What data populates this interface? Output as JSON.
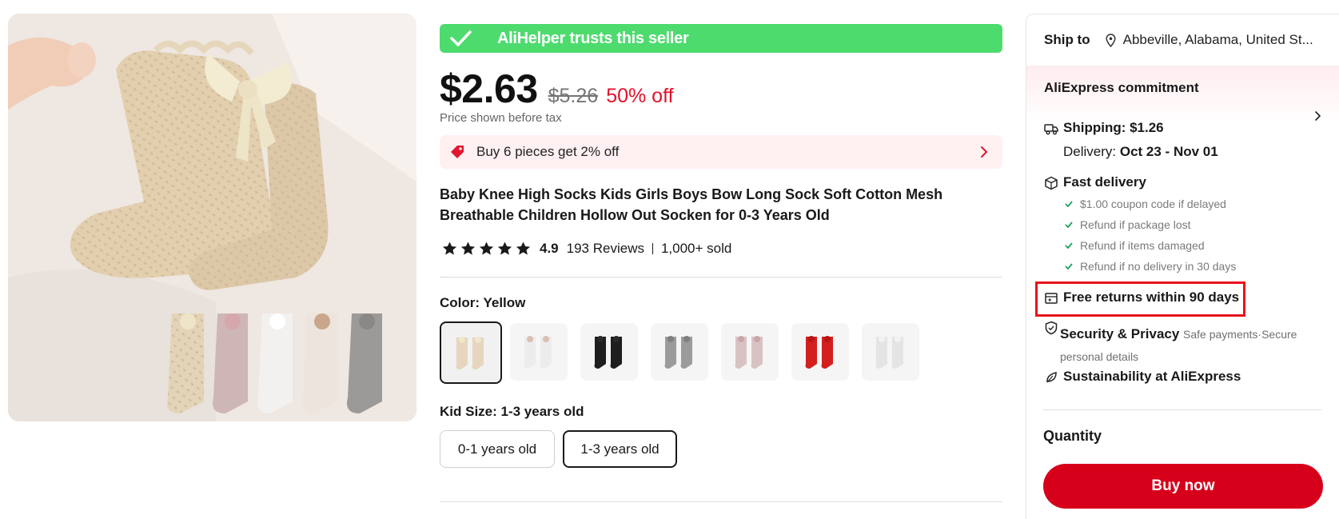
{
  "trust_banner": {
    "text": "AliHelper trusts this seller",
    "color": "#4ddb6e"
  },
  "price": {
    "current": "$2.63",
    "original": "$5.26",
    "discount": "50% off",
    "tax_note": "Price shown before tax"
  },
  "promo": {
    "text": "Buy 6 pieces get 2% off"
  },
  "product": {
    "title": "Baby Knee High Socks Kids Girls Boys Bow Long Sock Soft Cotton Mesh Breathable Children Hollow Out Socken for 0-3 Years Old",
    "rating": "4.9",
    "stars": 5,
    "reviews": "193 Reviews",
    "sold": "1,000+ sold"
  },
  "color": {
    "label": "Color: ",
    "selected": "Yellow",
    "swatches": [
      {
        "name": "yellow",
        "color": "#e6d6bd",
        "bow": "#efe6cc"
      },
      {
        "name": "white",
        "color": "#ececec",
        "bow": "#d9c0b3"
      },
      {
        "name": "black",
        "color": "#1e1e1e",
        "bow": "#2a2a2a"
      },
      {
        "name": "gray",
        "color": "#9b9b9b",
        "bow": "#7f7f7f"
      },
      {
        "name": "pink",
        "color": "#d8c3c3",
        "bow": "#c9a6a6"
      },
      {
        "name": "red",
        "color": "#d41f1f",
        "bow": "#b81515"
      },
      {
        "name": "light-white",
        "color": "#e4e4e4",
        "bow": "#f2f2f2"
      }
    ]
  },
  "size": {
    "label": "Kid Size: ",
    "selected": "1-3 years old",
    "options": [
      "0-1 years old",
      "1-3 years old"
    ]
  },
  "side": {
    "ship_to_label": "Ship to",
    "ship_to_address": "Abbeville, Alabama, United St...",
    "commitment_title": "AliExpress commitment",
    "shipping_label": "Shipping: $1.26",
    "delivery_label": "Delivery: ",
    "delivery_dates": "Oct 23 - Nov 01",
    "fast_delivery_title": "Fast delivery",
    "fast_delivery_items": [
      "$1.00 coupon code if delayed",
      "Refund if package lost",
      "Refund if items damaged",
      "Refund if no delivery in 30 days"
    ],
    "free_returns": "Free returns within 90 days",
    "security_title": "Security & Privacy",
    "security_desc": "Safe payments·Secure personal details",
    "sustainability": "Sustainability at AliExpress",
    "quantity_label": "Quantity",
    "buy_now": "Buy now",
    "buy_color": "#d7001b",
    "highlight_color": "#e8141b"
  }
}
